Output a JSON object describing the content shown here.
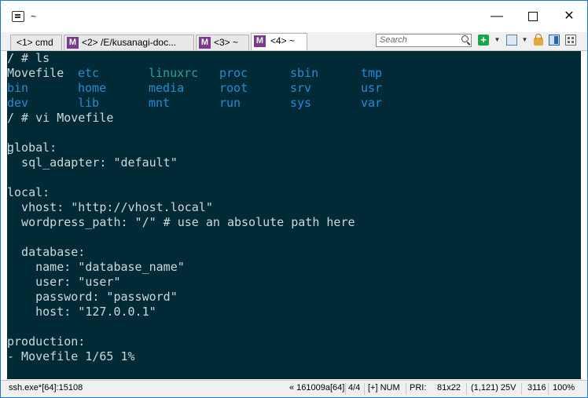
{
  "window": {
    "title": "~",
    "min_glyph": "—",
    "close_glyph": "✕"
  },
  "tabs": [
    {
      "label": "<1> cmd"
    },
    {
      "label": "<2> /E/kusanagi-doc..."
    },
    {
      "label": "<3> ~"
    },
    {
      "label": "<4> ~"
    }
  ],
  "tab_icon_letter": "M",
  "search": {
    "placeholder": "Search"
  },
  "toolbar_icons": [
    "new-console-icon",
    "dropdown-icon",
    "window-icon",
    "dropdown-icon",
    "lock-icon",
    "panel-icon",
    "grid-icon"
  ],
  "terminal": {
    "colors": {
      "background": "#002b36",
      "text": "#cdd8dc",
      "dir_blue": "#268bd2",
      "link_cyan": "#2aa198"
    },
    "prompt_ls": "/ # ls",
    "ls_rows": [
      [
        "Movefile",
        "etc",
        "linuxrc",
        "proc",
        "sbin",
        "tmp"
      ],
      [
        "bin",
        "home",
        "media",
        "root",
        "srv",
        "usr"
      ],
      [
        "dev",
        "lib",
        "mnt",
        "run",
        "sys",
        "var"
      ]
    ],
    "prompt_vi": "/ # vi Movefile",
    "file_lines": [
      "global:",
      "  sql_adapter: \"default\"",
      "",
      "local:",
      "  vhost: \"http://vhost.local\"",
      "  wordpress_path: \"/\" # use an absolute path here",
      "",
      "  database:",
      "    name: \"database_name\"",
      "    user: \"user\"",
      "    password: \"password\"",
      "    host: \"127.0.0.1\"",
      "",
      "production:"
    ],
    "vi_status": "- Movefile 1/65 1%"
  },
  "statusbar": {
    "left": "ssh.exe*[64]:15108",
    "process": "« 161009a[64]",
    "console": "4/4",
    "keys": "[+] NUM",
    "priority": "PRI:",
    "size": "81x22",
    "cursor": "(1,121) 25V",
    "pid": "3116",
    "zoom": "100%"
  }
}
